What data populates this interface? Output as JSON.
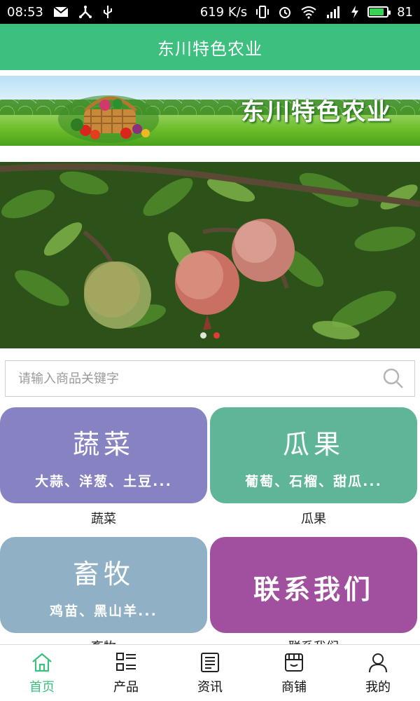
{
  "status_bar": {
    "time": "08:53",
    "net_speed": "619 K/s",
    "battery": "81",
    "battery_level": 0.81
  },
  "header": {
    "title": "东川特色农业"
  },
  "banner": {
    "title": "东川特色农业"
  },
  "carousel": {
    "slides": 2,
    "active_index": 1
  },
  "search": {
    "placeholder": "请输入商品关键字"
  },
  "categories": [
    {
      "title": "蔬菜",
      "subtitle": "大蒜、洋葱、土豆...",
      "label": "蔬菜",
      "color": "#8783c3"
    },
    {
      "title": "瓜果",
      "subtitle": "葡萄、石榴、甜瓜...",
      "label": "瓜果",
      "color": "#5fb597"
    },
    {
      "title": "畜牧",
      "subtitle": "鸡苗、黑山羊...",
      "label": "畜牧",
      "color": "#8fb0c5"
    },
    {
      "title": "联系我们",
      "label": "联系我们",
      "color": "#a0509f"
    }
  ],
  "bottom_nav": {
    "active_color": "#3cbf7f",
    "items": [
      {
        "label": "首页",
        "icon": "home-icon",
        "active": true
      },
      {
        "label": "产品",
        "icon": "grid-list-icon",
        "active": false
      },
      {
        "label": "资讯",
        "icon": "news-icon",
        "active": false
      },
      {
        "label": "商铺",
        "icon": "store-icon",
        "active": false
      },
      {
        "label": "我的",
        "icon": "user-icon",
        "active": false
      }
    ]
  }
}
